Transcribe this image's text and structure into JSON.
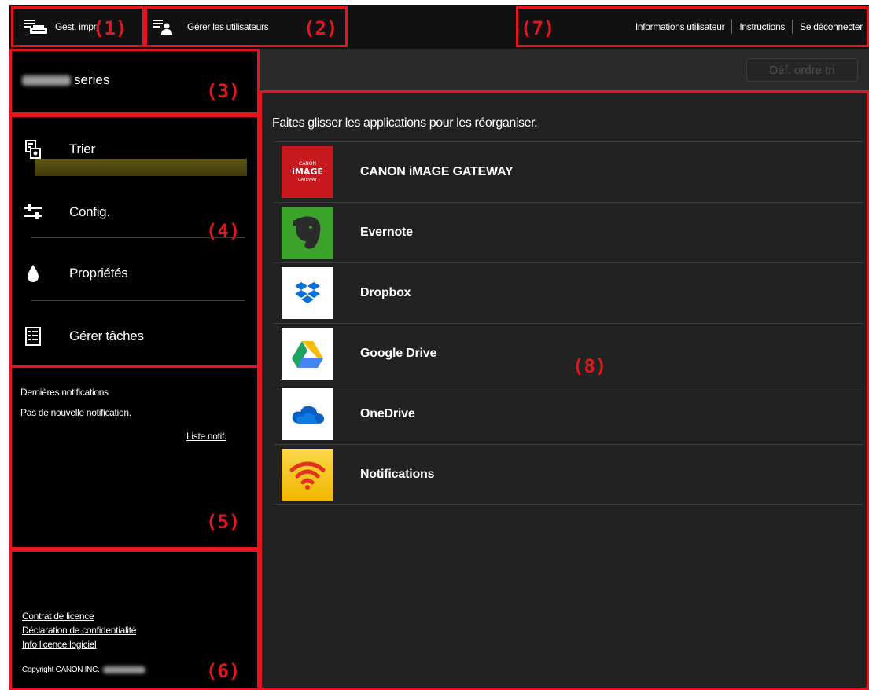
{
  "topbar": {
    "printer_mgmt": "Gest. impr.",
    "manage_users": "Gérer les utilisateurs",
    "links": [
      "Informations utilisateur",
      "Instructions",
      "Se déconnecter"
    ]
  },
  "sidebar": {
    "printer_series": "series",
    "nav": [
      {
        "label": "Trier",
        "icon": "sort-icon",
        "active": true
      },
      {
        "label": "Config.",
        "icon": "settings-sliders-icon"
      },
      {
        "label": "Propriétés",
        "icon": "ink-drop-icon"
      },
      {
        "label": "Gérer tâches",
        "icon": "task-list-icon"
      }
    ],
    "notifications": {
      "title": "Dernières notifications",
      "empty": "Pas de nouvelle notification.",
      "list_link": "Liste notif."
    },
    "footer": {
      "links": [
        "Contrat de licence",
        "Déclaration de confidentialité",
        "Info licence logiciel"
      ],
      "copyright": "Copyright CANON INC."
    }
  },
  "main": {
    "sort_button": "Déf. ordre tri",
    "hint": "Faites glisser les applications pour les réorganiser.",
    "apps": [
      {
        "name": "CANON iMAGE GATEWAY",
        "icon": "canon-image-gateway-icon",
        "color": "#c8191e",
        "logo_text": [
          "CANON",
          "iMAGE",
          "GATEWAY"
        ]
      },
      {
        "name": "Evernote",
        "icon": "evernote-icon",
        "color": "#3ca32a"
      },
      {
        "name": "Dropbox",
        "icon": "dropbox-icon",
        "color": "#0a6fd6"
      },
      {
        "name": "Google Drive",
        "icon": "google-drive-icon",
        "color": "#fbbc04"
      },
      {
        "name": "OneDrive",
        "icon": "onedrive-icon",
        "color": "#0a5fc4"
      },
      {
        "name": "Notifications",
        "icon": "notifications-wifi-icon",
        "color": "#f7c20e"
      }
    ]
  },
  "annotations": [
    "(1)",
    "(2)",
    "(3)",
    "(4)",
    "(5)",
    "(6)",
    "(7)",
    "(8)"
  ]
}
